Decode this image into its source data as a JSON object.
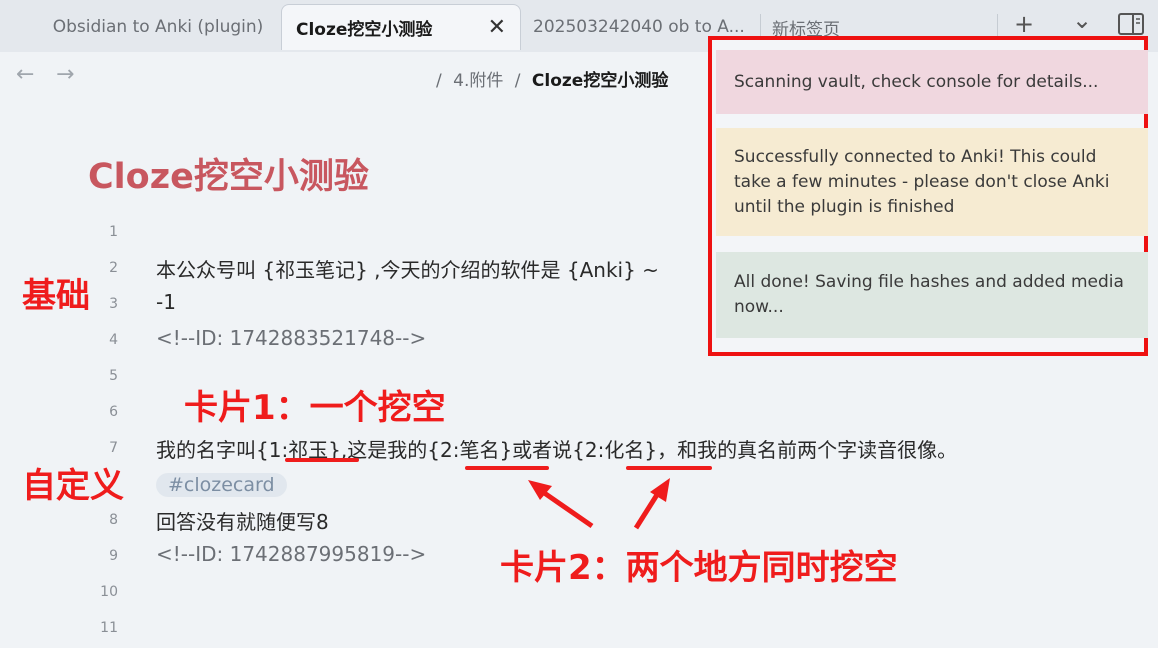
{
  "tabs": [
    {
      "label": "Obsidian to Anki (plugin)"
    },
    {
      "label": "Cloze挖空小测验"
    },
    {
      "label": "202503242040 ob to A..."
    },
    {
      "label": "新标签页"
    }
  ],
  "tab_actions": {
    "new_tab_icon": "+",
    "dropdown_icon": "⌄",
    "sidebar_icon": "sidebar-toggle-icon"
  },
  "breadcrumb": {
    "sep": "/",
    "folder": "4.附件",
    "current": "Cloze挖空小测验"
  },
  "document": {
    "title": "Cloze挖空小测验",
    "line_numbers": [
      "1",
      "2",
      "3",
      "4",
      "5",
      "6",
      "7",
      "8",
      "9",
      "10",
      "11"
    ],
    "lines": {
      "l2": "本公众号叫 {祁玉笔记} ,今天的介绍的软件是 {Anki} ~",
      "l3": "-1",
      "l4": "<!--ID: 1742883521748-->",
      "l7": "我的名字叫{1:祁玉},这是我的{2:笔名}或者说{2:化名}，和我的真名前两个字读音很像。",
      "tag": "#clozecard",
      "l8": "回答没有就随便写8",
      "l9": "<!--ID: 1742887995819-->"
    }
  },
  "annotations": {
    "basic": "基础",
    "custom": "自定义",
    "card1": "卡片1：一个挖空",
    "card2": "卡片2：两个地方同时挖空",
    "color": "#ef1c1c"
  },
  "notices": [
    {
      "text": "Scanning vault, check console for details..."
    },
    {
      "text": "Successfully connected to Anki! This could take a few minutes - please don't close Anki until the plugin is finished"
    },
    {
      "text": "All done! Saving file hashes and added media now..."
    }
  ]
}
